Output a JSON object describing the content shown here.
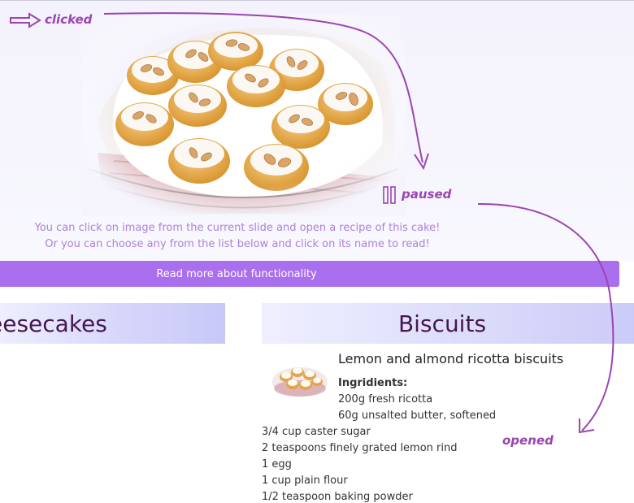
{
  "annotations": {
    "clicked": "clicked",
    "paused": "paused",
    "opened": "opened"
  },
  "slider": {
    "image": "cookies-with-almonds-image",
    "notice_line1": "You can click on image from the current slide and open a recipe of this cake!",
    "notice_line2": "Or you can choose any from the list below and click on its name to read!"
  },
  "read_more_label": "Read more about functionality",
  "categories": {
    "cheesecakes": "eesecakes",
    "biscuits": "Biscuits"
  },
  "recipe": {
    "title": "Lemon and almond ricotta biscuits",
    "ingredients_heading": "Ingridients:",
    "ingredients": [
      "200g fresh ricotta",
      "60g unsalted butter, softened",
      "3/4 cup caster sugar",
      "2 teaspoons finely grated lemon rind",
      "1 egg",
      "1 cup plain flour",
      "1/2 teaspoon baking powder"
    ]
  },
  "colors": {
    "accent": "#aa6fee",
    "notice_text": "#b080d8",
    "annotation": "#9a45b2",
    "category_text": "#44174f"
  }
}
